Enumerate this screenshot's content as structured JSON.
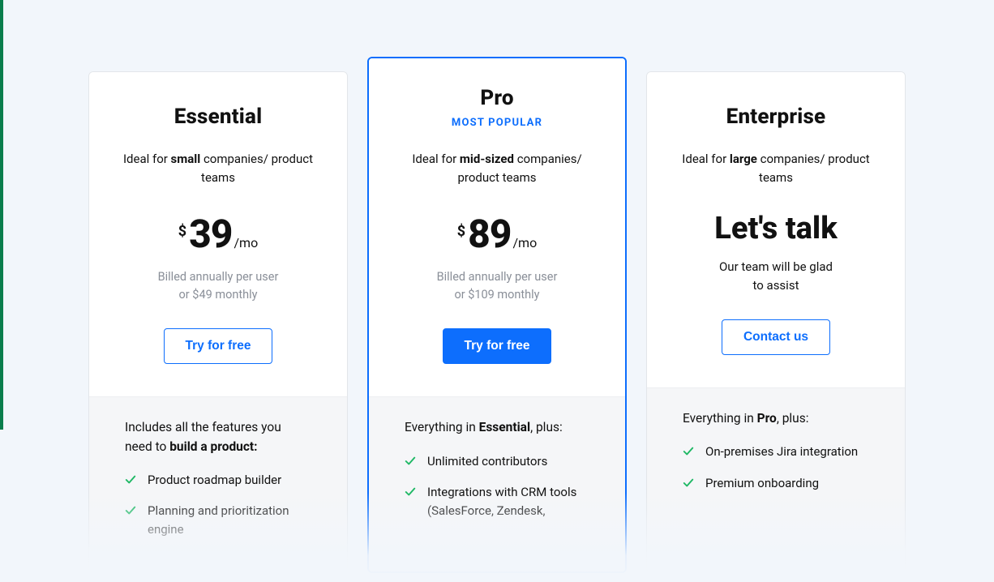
{
  "plans": {
    "essential": {
      "name": "Essential",
      "desc_pre": "Ideal for ",
      "desc_bold": "small",
      "desc_post": " companies/ product teams",
      "currency": "$",
      "amount": "39",
      "period": "/mo",
      "billing_l1": "Billed annually per user",
      "billing_l2": "or $49 monthly",
      "cta": "Try for free",
      "features_title_pre": "Includes all the features you need to ",
      "features_title_bold": "build a product:",
      "features": [
        "Product roadmap builder",
        "Planning and prioritization engine"
      ]
    },
    "pro": {
      "name": "Pro",
      "badge": "MOST POPULAR",
      "desc_pre": "Ideal for ",
      "desc_bold": "mid-sized",
      "desc_post": " companies/ product teams",
      "currency": "$",
      "amount": "89",
      "period": "/mo",
      "billing_l1": "Billed annually per user",
      "billing_l2": "or $109 monthly",
      "cta": "Try for free",
      "features_title_pre": "Everything in ",
      "features_title_bold": "Essential",
      "features_title_post": ", plus:",
      "features": [
        "Unlimited contributors",
        "Integrations with CRM tools (SalesForce, Zendesk,"
      ]
    },
    "enterprise": {
      "name": "Enterprise",
      "desc_pre": "Ideal for ",
      "desc_bold": "large",
      "desc_post": " companies/ product teams",
      "lets_talk": "Let's talk",
      "assist_l1": "Our team will be glad",
      "assist_l2": "to assist",
      "cta": "Contact us",
      "features_title_pre": "Everything in ",
      "features_title_bold": "Pro",
      "features_title_post": ", plus:",
      "features": [
        "On-premises Jira integration",
        "Premium onboarding"
      ]
    }
  }
}
